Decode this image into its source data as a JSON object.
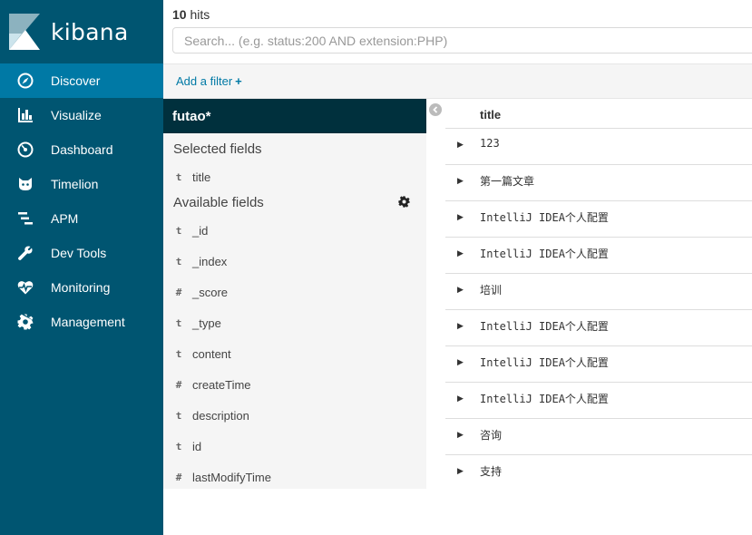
{
  "app": {
    "name": "kibana"
  },
  "sidebar": {
    "items": [
      {
        "label": "Discover",
        "icon": "compass-icon",
        "active": true
      },
      {
        "label": "Visualize",
        "icon": "bar-chart-icon"
      },
      {
        "label": "Dashboard",
        "icon": "dashboard-gauge-icon"
      },
      {
        "label": "Timelion",
        "icon": "timelion-cat-icon"
      },
      {
        "label": "APM",
        "icon": "apm-bars-icon"
      },
      {
        "label": "Dev Tools",
        "icon": "wrench-icon"
      },
      {
        "label": "Monitoring",
        "icon": "heartbeat-icon"
      },
      {
        "label": "Management",
        "icon": "gear-icon"
      }
    ]
  },
  "hits": {
    "count": "10",
    "label": "hits"
  },
  "search": {
    "placeholder": "Search... (e.g. status:200 AND extension:PHP)",
    "value": ""
  },
  "filter": {
    "add_label": "Add a filter",
    "plus": "+"
  },
  "field_panel": {
    "index_pattern": "futao*",
    "selected_title": "Selected fields",
    "selected_fields": [
      {
        "type": "t",
        "name": "title"
      }
    ],
    "available_title": "Available fields",
    "available_fields": [
      {
        "type": "t",
        "name": "_id"
      },
      {
        "type": "t",
        "name": "_index"
      },
      {
        "type": "#",
        "name": "_score"
      },
      {
        "type": "t",
        "name": "_type"
      },
      {
        "type": "t",
        "name": "content"
      },
      {
        "type": "#",
        "name": "createTime"
      },
      {
        "type": "t",
        "name": "description"
      },
      {
        "type": "t",
        "name": "id"
      },
      {
        "type": "#",
        "name": "lastModifyTime"
      }
    ]
  },
  "table": {
    "columns": [
      "title"
    ],
    "rows": [
      "123",
      "第一篇文章",
      "IntelliJ IDEA个人配置",
      "IntelliJ IDEA个人配置",
      "培训",
      "IntelliJ IDEA个人配置",
      "IntelliJ IDEA个人配置",
      "IntelliJ IDEA个人配置",
      "咨询",
      "支持"
    ]
  }
}
